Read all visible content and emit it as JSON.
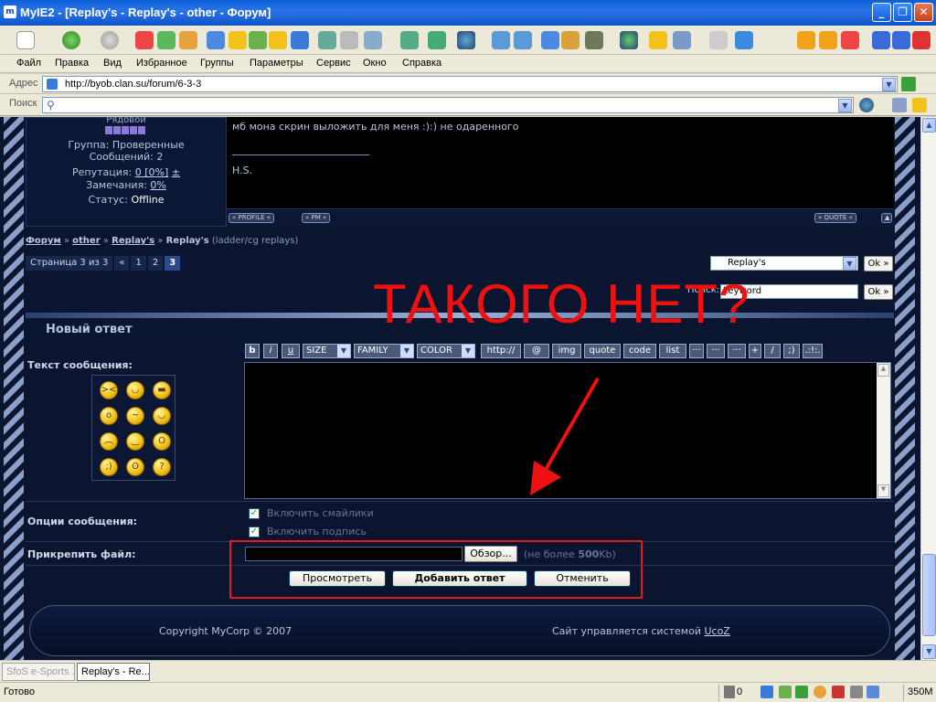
{
  "window": {
    "title": "MyIE2 - [Replay's - Replay's - other - Форум]",
    "app_icon": "myie-icon"
  },
  "menu": [
    "Файл",
    "Правка",
    "Вид",
    "Избранное",
    "Группы",
    "Параметры",
    "Сервис",
    "Окно",
    "Справка"
  ],
  "address": {
    "label": "Адрес",
    "url": "http://byob.clan.su/forum/6-3-3"
  },
  "search": {
    "label": "Поиск",
    "value": ""
  },
  "user": {
    "rank": "Рядовой",
    "group": "Группа: Проверенные",
    "posts": "Сообщений: 2",
    "reputation_label": "Репутация:",
    "reputation_value": "0 [0%]",
    "reputation_pm": "±",
    "warnings_label": "Замечания:",
    "warnings_value": "0%",
    "status_label": "Статус:",
    "status_value": "Offline"
  },
  "post": {
    "text": "мб мона скрин выложить для меня :):) не одаренного",
    "signature": "H.S.",
    "buttons": {
      "profile": "PROFILE",
      "pm": "PM",
      "quote": "QUOTE"
    }
  },
  "breadcrumb": {
    "forum": "Форум",
    "sep": "»",
    "other": "other",
    "replays": "Replay's",
    "current": "Replay's",
    "suffix": "(ladder/cg replays)"
  },
  "pager": {
    "label": "Страница 3 из 3",
    "prev": "«",
    "pages": [
      "1",
      "2",
      "3"
    ],
    "current": "3"
  },
  "forum_select": {
    "value": "Replay's",
    "ok": "Ok »"
  },
  "search_forum": {
    "label": "Поиск:",
    "value": "keyword",
    "ok": "Ok »"
  },
  "annotation": {
    "text": "ТАКОГО НЕТ?",
    "color": "#ee1111"
  },
  "reply": {
    "heading": "Новый ответ",
    "message_label": "Текст сообщения:",
    "bb_buttons": [
      "b",
      "i",
      "u"
    ],
    "bb_selects": [
      "SIZE",
      "FAMILY",
      "COLOR"
    ],
    "bb_tags": [
      "http://",
      "@",
      "img",
      "quote",
      "code",
      "list",
      "···",
      "···",
      "···",
      "+",
      "/",
      ";)",
      ".:!:."
    ],
    "smileys": [
      "angry-smiley-icon",
      "laugh-smiley-icon",
      "cool-smiley-icon",
      "shock-smiley-icon",
      "smirk-smiley-icon",
      "happy-smiley-icon",
      "sad-smiley-icon",
      "smile-smiley-icon",
      "surprised-smiley-icon",
      "wink-smiley-icon",
      "cry-smiley-icon",
      "grin-smiley-icon"
    ],
    "options_label": "Опции сообщения:",
    "opt_smileys": "Включить смайлики",
    "opt_signature": "Включить подпись",
    "attach_label": "Прикрепить файл:",
    "browse": "Обзор...",
    "limit_prefix": "(не более ",
    "limit_value": "500",
    "limit_suffix": "Kb)",
    "preview": "Просмотреть",
    "submit": "Добавить ответ",
    "cancel": "Отменить"
  },
  "footer": {
    "copyright": "Copyright MyCorp © 2007",
    "powered": "Сайт управляется системой",
    "system": "UcoZ"
  },
  "tabs": [
    {
      "label": "SfoS e-Sports ...",
      "active": false
    },
    {
      "label": "Replay's - Re...",
      "active": true
    }
  ],
  "status": {
    "text": "Готово",
    "popups": "0",
    "memory": "350M"
  }
}
